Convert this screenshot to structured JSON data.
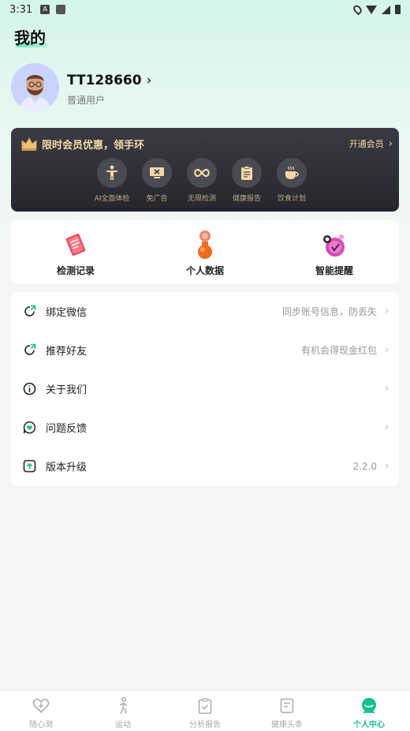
{
  "status_bar": {
    "time": "3:31",
    "badge": "A"
  },
  "page_title": "我的",
  "profile": {
    "username": "TT128660",
    "level": "普通用户"
  },
  "vip": {
    "title": "限时会员优惠，领手环",
    "open_label": "开通会员",
    "features": [
      {
        "label": "AI全面体检",
        "icon": "body-icon"
      },
      {
        "label": "免广告",
        "icon": "no-ads-icon"
      },
      {
        "label": "无限检测",
        "icon": "infinity-icon"
      },
      {
        "label": "健康报告",
        "icon": "report-icon"
      },
      {
        "label": "饮食计划",
        "icon": "cup-icon"
      }
    ]
  },
  "quick_actions": [
    {
      "label": "检测记录",
      "icon": "record-icon"
    },
    {
      "label": "个人数据",
      "icon": "person-data-icon"
    },
    {
      "label": "智能提醒",
      "icon": "reminder-icon"
    }
  ],
  "menu": [
    {
      "label": "绑定微信",
      "right": "同步账号信息，防丢失",
      "icon": "refresh-arrow-icon"
    },
    {
      "label": "推荐好友",
      "right": "有机会得现金红包",
      "icon": "refresh-arrow-icon"
    },
    {
      "label": "关于我们",
      "right": "",
      "icon": "info-icon"
    },
    {
      "label": "问题反馈",
      "right": "",
      "icon": "feedback-heart-icon"
    },
    {
      "label": "版本升级",
      "right": "2.2.0",
      "icon": "upgrade-icon"
    }
  ],
  "bottom_nav": [
    {
      "label": "随心测",
      "icon": "heart-plus-icon",
      "active": false
    },
    {
      "label": "运动",
      "icon": "runner-icon",
      "active": false
    },
    {
      "label": "分析报告",
      "icon": "clipboard-check-icon",
      "active": false
    },
    {
      "label": "健康头条",
      "icon": "news-icon",
      "active": false
    },
    {
      "label": "个人中心",
      "icon": "profile-center-icon",
      "active": true
    }
  ],
  "colors": {
    "accent": "#14c08f",
    "vip_gold": "#f3d9a6",
    "vip_bg": "#2e2e35"
  }
}
